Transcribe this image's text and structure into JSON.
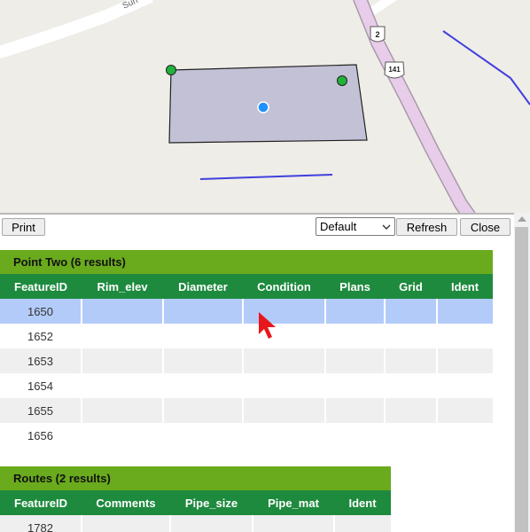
{
  "map": {
    "road_label": "Sun",
    "shields": [
      {
        "label": "2",
        "type": "interstate"
      },
      {
        "label": "141",
        "type": "us-highway"
      }
    ],
    "colors": {
      "polygon_fill": "#c3c1d6",
      "vertex": "#22b13a",
      "centroid": "#1e90ff",
      "line": "#4040dd",
      "highway": "#e8cdea"
    }
  },
  "toolbar": {
    "print_label": "Print",
    "layout_value": "Default",
    "refresh_label": "Refresh",
    "close_label": "Close"
  },
  "results": {
    "point_two": {
      "title": "Point Two (6 results)",
      "columns": [
        "FeatureID",
        "Rim_elev",
        "Diameter",
        "Condition",
        "Plans",
        "Grid",
        "Ident"
      ],
      "rows": [
        "1650",
        "1652",
        "1653",
        "1654",
        "1655",
        "1656"
      ]
    },
    "routes": {
      "title": "Routes (2 results)",
      "columns": [
        "FeatureID",
        "Comments",
        "Pipe_size",
        "Pipe_mat",
        "Ident"
      ],
      "rows": [
        "1782"
      ]
    }
  },
  "colors": {
    "layer_title_bg": "#6aaa1d",
    "header_bg": "#1e8a3e",
    "selected_row": "#b3cbf8",
    "alt_row": "#efefef",
    "cursor": "#e8171b"
  }
}
